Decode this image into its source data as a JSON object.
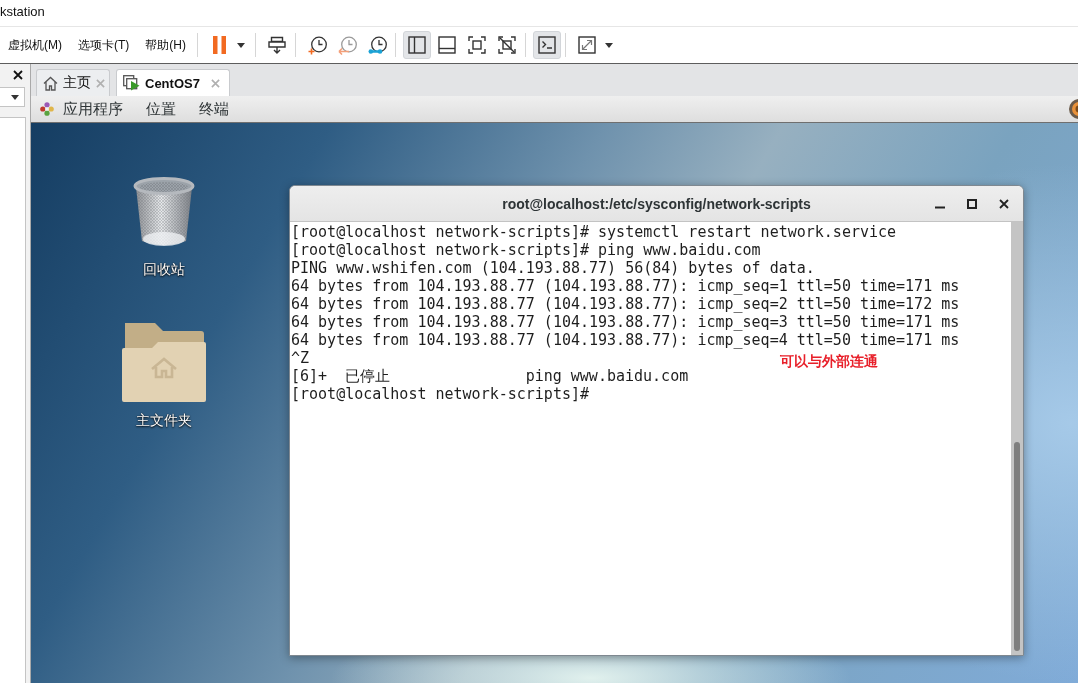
{
  "window": {
    "title": "kstation"
  },
  "menu": [
    {
      "label": "虚拟机(M)"
    },
    {
      "label": "选项卡(T)"
    },
    {
      "label": "帮助(H)"
    }
  ],
  "toolbar": {
    "toggles": [
      {
        "selected": true
      },
      {
        "selected": false
      },
      {
        "selected": false
      },
      {
        "selected": false
      },
      {
        "selected": true
      }
    ]
  },
  "tabs": [
    {
      "kind": "home",
      "label": "主页",
      "selected": false
    },
    {
      "kind": "vm",
      "label": "CentOS7",
      "selected": true
    }
  ],
  "gnome_bar": {
    "menus": [
      {
        "kind": "apps",
        "label": "应用程序"
      },
      {
        "kind": "plain",
        "label": "位置"
      },
      {
        "kind": "plain",
        "label": "终端"
      }
    ]
  },
  "desktop": {
    "icons": [
      {
        "kind": "trash",
        "label": "回收站"
      },
      {
        "kind": "home_folder",
        "label": "主文件夹"
      }
    ]
  },
  "terminal": {
    "title": "root@localhost:/etc/sysconfig/network-scripts",
    "lines": [
      "[root@localhost network-scripts]# systemctl restart network.service",
      "[root@localhost network-scripts]# ping www.baidu.com",
      "PING www.wshifen.com (104.193.88.77) 56(84) bytes of data.",
      "64 bytes from 104.193.88.77 (104.193.88.77): icmp_seq=1 ttl=50 time=171 ms",
      "64 bytes from 104.193.88.77 (104.193.88.77): icmp_seq=2 ttl=50 time=172 ms",
      "64 bytes from 104.193.88.77 (104.193.88.77): icmp_seq=3 ttl=50 time=171 ms",
      "64 bytes from 104.193.88.77 (104.193.88.77): icmp_seq=4 ttl=50 time=171 ms",
      "^Z",
      "[6]+  已停止               ping www.baidu.com",
      "[root@localhost network-scripts]#"
    ],
    "annotation": "可以与外部连通"
  }
}
